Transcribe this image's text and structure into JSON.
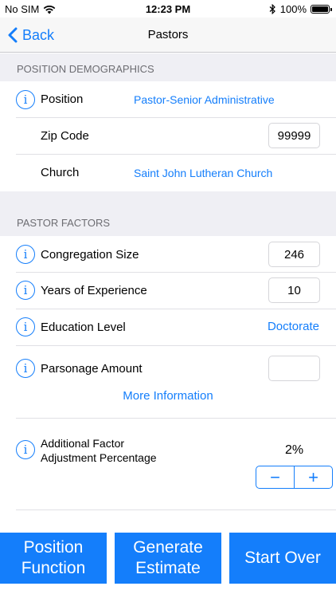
{
  "status_bar": {
    "carrier": "No SIM",
    "time": "12:23 PM",
    "battery": "100%",
    "battery_level": 1.0,
    "icons": [
      "wifi-icon",
      "bluetooth-icon",
      "battery-icon"
    ]
  },
  "nav": {
    "back_label": "Back",
    "title": "Pastors"
  },
  "sections": {
    "demographics_header": "POSITION DEMOGRAPHICS",
    "factors_header": "PASTOR FACTORS"
  },
  "demographics": {
    "position_label": "Position",
    "position_value": "Pastor-Senior Administrative",
    "zip_label": "Zip Code",
    "zip_value": "99999",
    "church_label": "Church",
    "church_value": "Saint John Lutheran Church"
  },
  "factors": {
    "congregation_label": "Congregation Size",
    "congregation_value": "246",
    "experience_label": "Years of Experience",
    "experience_value": "10",
    "education_label": "Education Level",
    "education_value": "Doctorate",
    "parsonage_label": "Parsonage Amount",
    "parsonage_value": "",
    "more_info_label": "More Information",
    "adjustment_label_line1": "Additional Factor",
    "adjustment_label_line2": "Adjustment Percentage",
    "adjustment_value": "2%",
    "stepper_minus": "−",
    "stepper_plus": "+"
  },
  "info_glyph": "i",
  "buttons": {
    "position_function_line1": "Position",
    "position_function_line2": "Function",
    "generate_estimate_line1": "Generate",
    "generate_estimate_line2": "Estimate",
    "start_over": "Start Over"
  },
  "colors": {
    "accent": "#147efb",
    "section_bg": "#efeff4",
    "section_text": "#6d6d72"
  }
}
